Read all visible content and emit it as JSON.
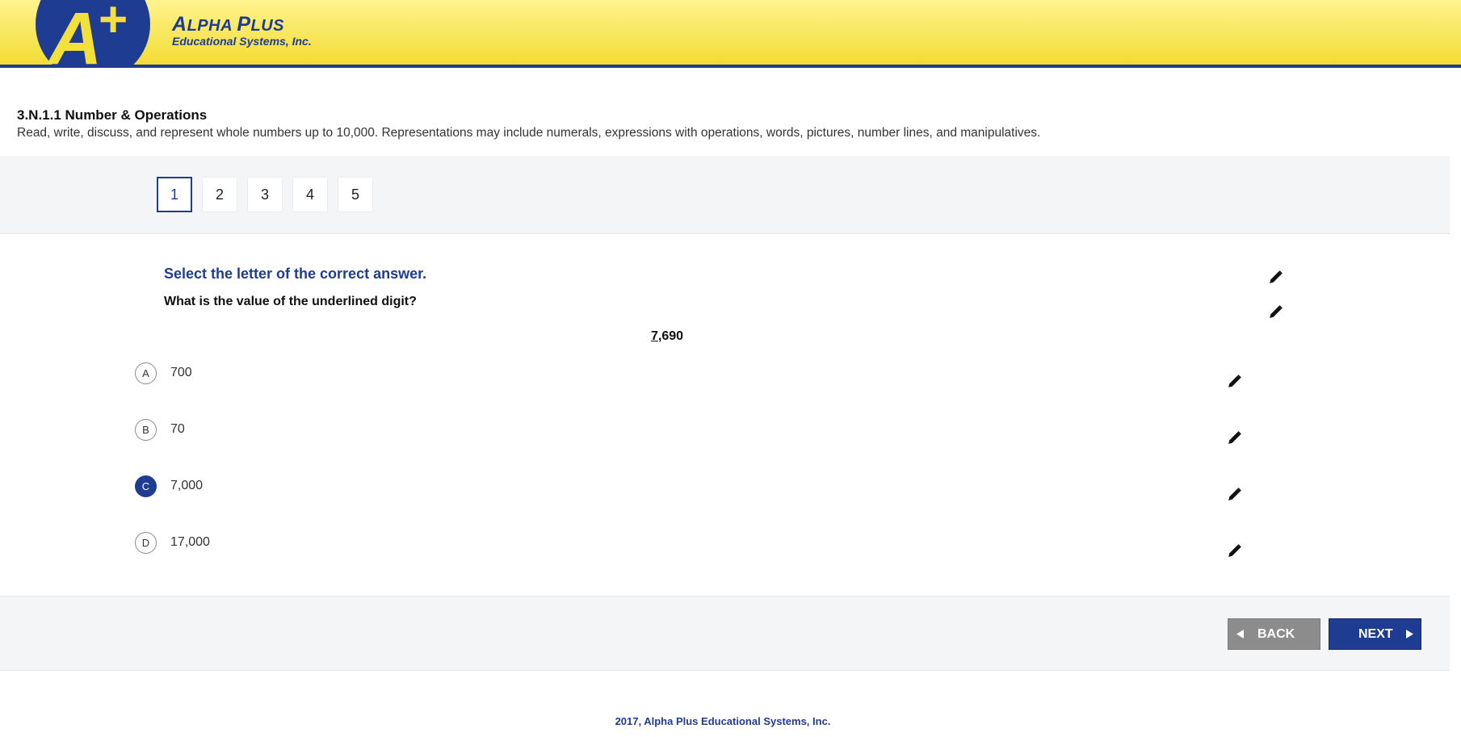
{
  "header": {
    "brand_name_first_letter": "A",
    "brand_name_rest": "LPHA ",
    "brand_name_second_first_letter": "P",
    "brand_name_second_rest": "LUS",
    "brand_subtitle": "Educational Systems, Inc.",
    "brand_color": "#1f3c93"
  },
  "standard": {
    "code_title": "3.N.1.1 Number & Operations",
    "description": "Read, write, discuss, and represent whole numbers up to 10,000. Representations may include numerals, expressions with operations, words, pictures, number lines, and manipulatives."
  },
  "question_nav": {
    "items": [
      "1",
      "2",
      "3",
      "4",
      "5"
    ],
    "active": "1"
  },
  "question": {
    "instruction": "Select the letter of the correct answer.",
    "prompt": "What is the value of the underlined digit?",
    "number_underlined": "7",
    "number_rest": ",690",
    "choices": [
      {
        "letter": "A",
        "text": "700"
      },
      {
        "letter": "B",
        "text": "70"
      },
      {
        "letter": "C",
        "text": "7,000"
      },
      {
        "letter": "D",
        "text": "17,000"
      }
    ],
    "selected": "C"
  },
  "icons": {
    "edit": "pencil-icon",
    "back": "triangle-left-icon",
    "next": "triangle-right-icon"
  },
  "buttons": {
    "back": "BACK",
    "next": "NEXT"
  },
  "footer": {
    "text": "2017, Alpha Plus Educational Systems, Inc."
  }
}
